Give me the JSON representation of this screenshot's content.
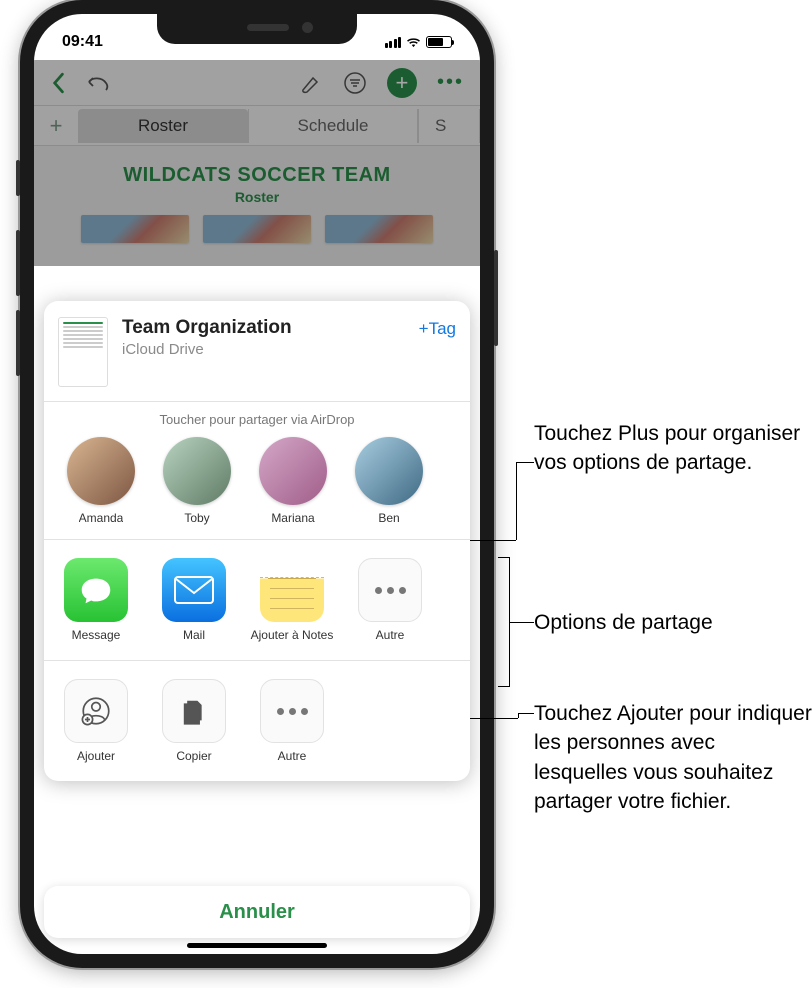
{
  "status": {
    "time": "09:41"
  },
  "background": {
    "tabs": [
      "Roster",
      "Schedule",
      "S"
    ],
    "doc_title": "WILDCATS SOCCER TEAM",
    "doc_subtitle": "Roster"
  },
  "sheet": {
    "file_title": "Team Organization",
    "file_location": "iCloud Drive",
    "tag_button": "+Tag",
    "airdrop_label": "Toucher pour partager via AirDrop",
    "contacts": [
      "Amanda",
      "Toby",
      "Mariana",
      "Ben"
    ],
    "apps": [
      {
        "id": "message",
        "label": "Message"
      },
      {
        "id": "mail",
        "label": "Mail"
      },
      {
        "id": "notes",
        "label": "Ajouter à Notes"
      },
      {
        "id": "more",
        "label": "Autre"
      }
    ],
    "actions": [
      {
        "id": "add-people",
        "label": "Ajouter"
      },
      {
        "id": "copy",
        "label": "Copier"
      },
      {
        "id": "more",
        "label": "Autre"
      }
    ],
    "cancel": "Annuler"
  },
  "callouts": {
    "c1": "Touchez Plus pour organiser vos options de partage.",
    "c2": "Options de partage",
    "c3": "Touchez Ajouter pour indiquer les personnes avec lesquelles vous souhaitez partager votre fichier."
  }
}
